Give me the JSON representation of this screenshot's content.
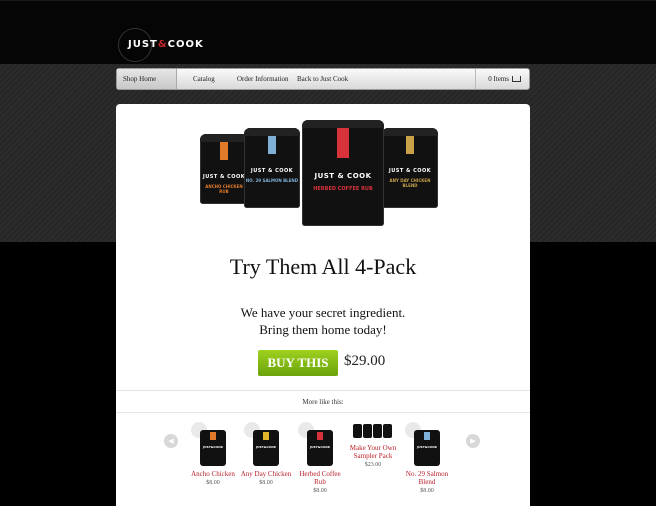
{
  "brand": {
    "logo_text": "JUST",
    "logo_amp": "&",
    "logo_text2": "COOK"
  },
  "nav": {
    "items": [
      "Shop Home",
      "Catalog",
      "Order Information",
      "Back to Just Cook"
    ],
    "cart_label": "0 Items"
  },
  "hero": {
    "tins": [
      {
        "flavor": "ANCHO CHICKEN RUB",
        "color": "#e07a2a"
      },
      {
        "flavor": "NO. 29 SALMON BLEND",
        "color": "#7fb0d8"
      },
      {
        "flavor": "HERBED COFFEE RUB",
        "color": "#d8323a"
      },
      {
        "flavor": "ANY DAY CHICKEN BLEND",
        "color": "#c9a24a"
      }
    ],
    "tin_brand": "JUST & COOK"
  },
  "product": {
    "title": "Try Them All 4-Pack",
    "tagline_line1": "We have your secret ingredient.",
    "tagline_line2": "Bring them home today!",
    "buy_label": "BUY THIS",
    "price": "$29.00",
    "accent_color": "#7ab816"
  },
  "related": {
    "heading": "More like this:",
    "items": [
      {
        "name": "Ancho Chicken",
        "price": "$8.00",
        "tag_color": "#e07a2a"
      },
      {
        "name": "Any Day Chicken",
        "price": "$8.00",
        "tag_color": "#e0b52a"
      },
      {
        "name": "Herbed Coffee Rub",
        "price": "$8.00",
        "tag_color": "#d8323a"
      },
      {
        "name": "Make Your Own Sampler Pack",
        "price": "$23.00",
        "tag_color": "#d8323a"
      },
      {
        "name": "No. 29 Salmon Blend",
        "price": "$8.00",
        "tag_color": "#7fb0d8"
      }
    ],
    "prev_icon": "chevron-left-icon",
    "next_icon": "chevron-right-icon"
  }
}
